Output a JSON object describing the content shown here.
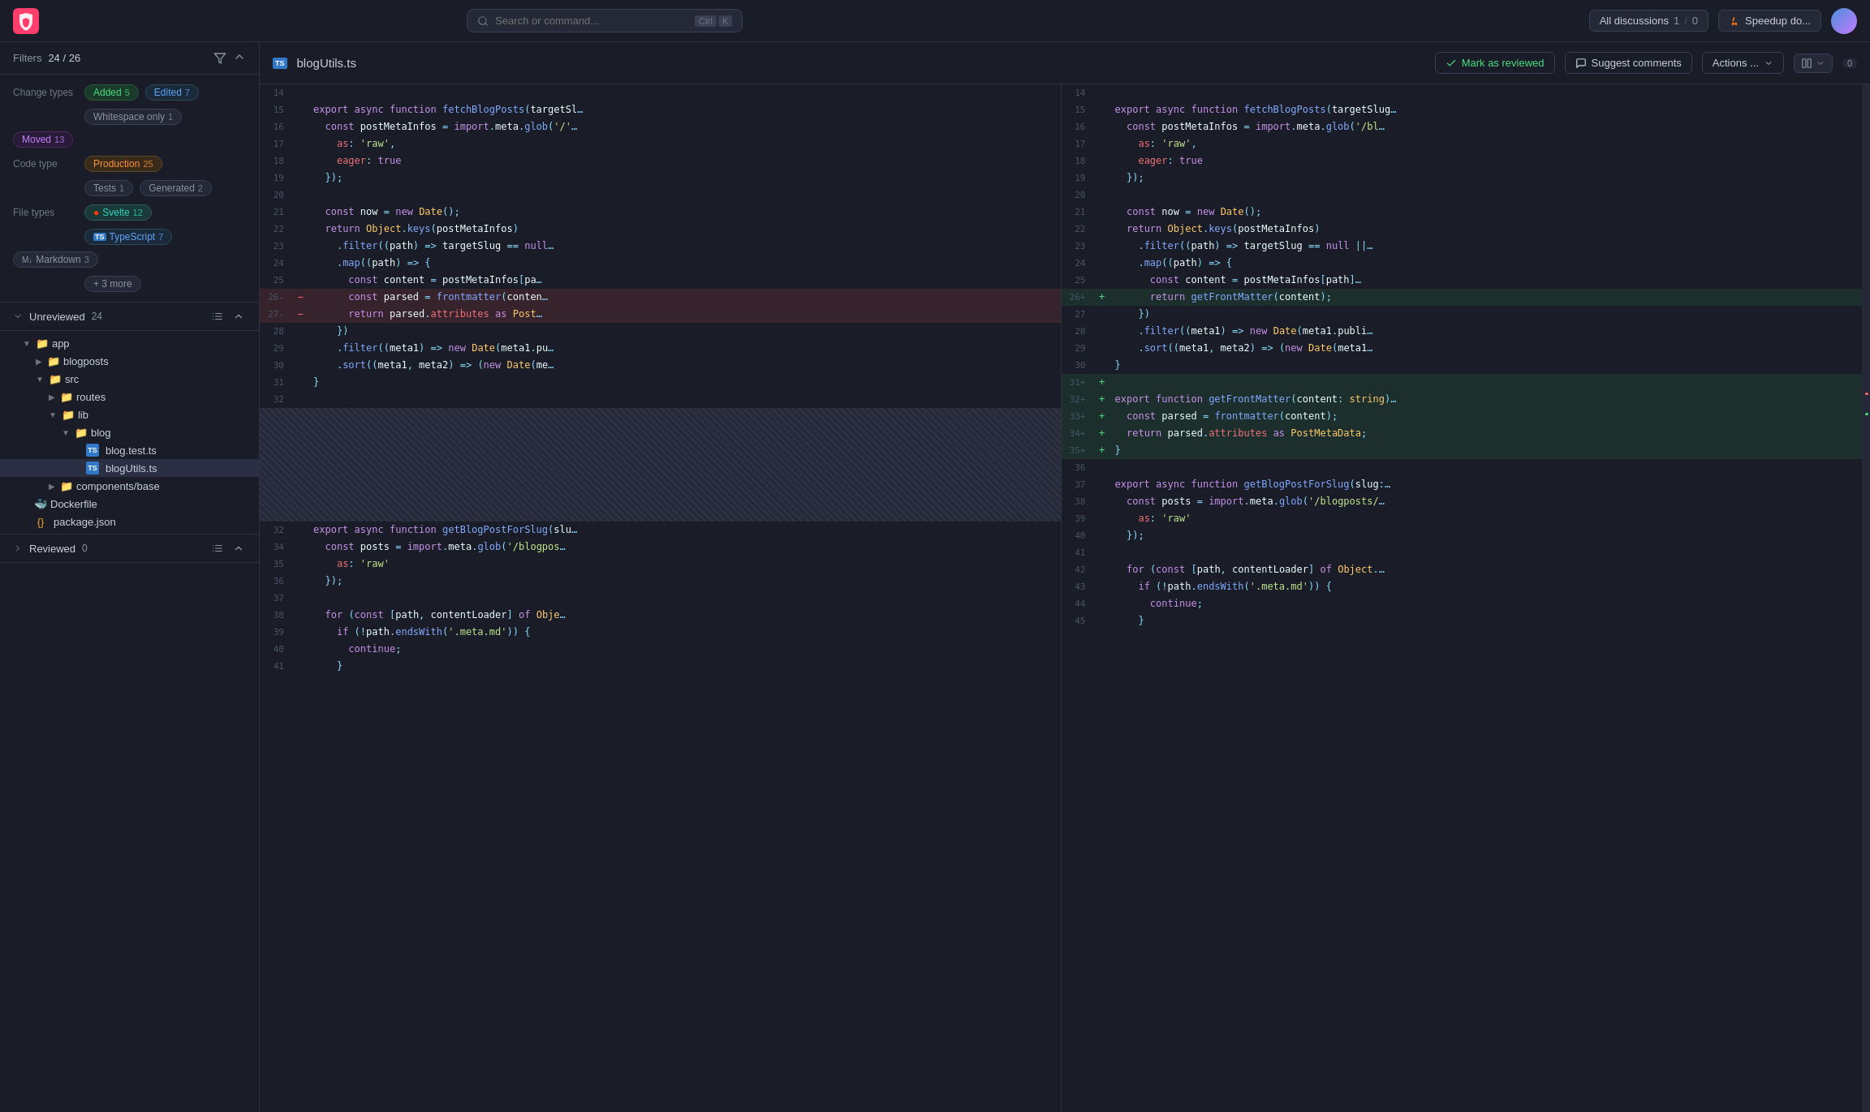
{
  "topbar": {
    "search_placeholder": "Search or command...",
    "kbd_ctrl": "Ctrl",
    "kbd_k": "K",
    "discussions_label": "All discussions",
    "discussions_count": "1",
    "discussions_zero": "0",
    "speedup_label": "Speedup do..."
  },
  "filters": {
    "title": "Filters",
    "count": "24 / 26",
    "change_types_label": "Change types",
    "added_label": "Added",
    "added_count": "5",
    "edited_label": "Edited",
    "edited_count": "7",
    "whitespace_label": "Whitespace only",
    "whitespace_count": "1",
    "moved_label": "Moved",
    "moved_count": "13",
    "code_type_label": "Code type",
    "production_label": "Production",
    "production_count": "25",
    "tests_label": "Tests",
    "tests_count": "1",
    "generated_label": "Generated",
    "generated_count": "2",
    "file_types_label": "File types",
    "svelte_label": "Svelte",
    "svelte_count": "12",
    "typescript_label": "TypeScript",
    "typescript_count": "7",
    "markdown_label": "Markdown",
    "markdown_count": "3",
    "more_label": "+ 3 more"
  },
  "unreviewed": {
    "title": "Unreviewed",
    "count": "24"
  },
  "reviewed": {
    "title": "Reviewed",
    "count": "0"
  },
  "file_tree": [
    {
      "name": "app",
      "type": "folder",
      "indent": 1,
      "expanded": true
    },
    {
      "name": "blogposts",
      "type": "folder",
      "indent": 2,
      "expanded": false
    },
    {
      "name": "src",
      "type": "folder",
      "indent": 2,
      "expanded": true
    },
    {
      "name": "routes",
      "type": "folder",
      "indent": 3,
      "expanded": false
    },
    {
      "name": "lib",
      "type": "folder",
      "indent": 3,
      "expanded": true
    },
    {
      "name": "blog",
      "type": "folder",
      "indent": 4,
      "expanded": true
    },
    {
      "name": "blog.test.ts",
      "type": "ts",
      "indent": 5
    },
    {
      "name": "blogUtils.ts",
      "type": "ts",
      "indent": 5,
      "active": true
    },
    {
      "name": "components/base",
      "type": "folder",
      "indent": 3,
      "expanded": false
    },
    {
      "name": "Dockerfile",
      "type": "docker",
      "indent": 1
    },
    {
      "name": "package.json",
      "type": "json",
      "indent": 1
    }
  ],
  "file": {
    "name": "blogUtils.ts",
    "mark_reviewed_label": "Mark as reviewed",
    "suggest_label": "Suggest comments",
    "actions_label": "Actions ...",
    "comment_count": "0"
  },
  "diff": {
    "left_lines": [
      {
        "num": "14",
        "type": "normal",
        "content": ""
      },
      {
        "num": "15",
        "type": "normal",
        "content": "export async function fetchBlogPosts(targetSl"
      },
      {
        "num": "16",
        "type": "normal",
        "content": "  const postMetaInfos = import.meta.glob('/'"
      },
      {
        "num": "17",
        "type": "normal",
        "content": "    as: 'raw',"
      },
      {
        "num": "18",
        "type": "normal",
        "content": "    eager: true"
      },
      {
        "num": "19",
        "type": "normal",
        "content": "  });"
      },
      {
        "num": "20",
        "type": "normal",
        "content": ""
      },
      {
        "num": "21",
        "type": "normal",
        "content": "  const now = new Date();"
      },
      {
        "num": "22",
        "type": "normal",
        "content": "  return Object.keys(postMetaInfos)"
      },
      {
        "num": "23",
        "type": "normal",
        "content": "    .filter((path) => targetSlug == null"
      },
      {
        "num": "24",
        "type": "normal",
        "content": "    .map((path) => {"
      },
      {
        "num": "25",
        "type": "normal",
        "content": "      const content = postMetaInfos[pa"
      },
      {
        "num": "26",
        "type": "removed",
        "content": "      const parsed = frontmatter(conten"
      },
      {
        "num": "27",
        "type": "removed",
        "content": "      return parsed.attributes as Post"
      },
      {
        "num": "28",
        "type": "normal",
        "content": "    })"
      },
      {
        "num": "29",
        "type": "normal",
        "content": "    .filter((meta1) => new Date(meta1.pu"
      },
      {
        "num": "30",
        "type": "normal",
        "content": "    .sort((meta1, meta2) => (new Date(me"
      },
      {
        "num": "31",
        "type": "normal",
        "content": "}"
      },
      {
        "num": "32",
        "type": "normal",
        "content": ""
      },
      {
        "num": "",
        "type": "empty",
        "content": ""
      },
      {
        "num": "",
        "type": "empty",
        "content": ""
      },
      {
        "num": "",
        "type": "empty",
        "content": ""
      },
      {
        "num": "",
        "type": "empty",
        "content": ""
      },
      {
        "num": "",
        "type": "empty",
        "content": ""
      },
      {
        "num": "",
        "type": "empty",
        "content": ""
      },
      {
        "num": "",
        "type": "empty",
        "content": ""
      },
      {
        "num": "",
        "type": "empty",
        "content": ""
      },
      {
        "num": "",
        "type": "empty",
        "content": ""
      },
      {
        "num": "32",
        "type": "normal",
        "content": "export async function getBlogPostForSlug(slu"
      },
      {
        "num": "34",
        "type": "normal",
        "content": "  const posts = import.meta.glob('/blogpos"
      },
      {
        "num": "35",
        "type": "normal",
        "content": "    as: 'raw'"
      },
      {
        "num": "36",
        "type": "normal",
        "content": "  });"
      },
      {
        "num": "37",
        "type": "normal",
        "content": ""
      },
      {
        "num": "38",
        "type": "normal",
        "content": "  for (const [path, contentLoader] of Obje"
      },
      {
        "num": "39",
        "type": "normal",
        "content": "    if (!path.endsWith('.meta.md')) {"
      },
      {
        "num": "40",
        "type": "normal",
        "content": "      continue;"
      },
      {
        "num": "41",
        "type": "normal",
        "content": "    }"
      }
    ],
    "right_lines": [
      {
        "num": "14",
        "type": "normal",
        "content": ""
      },
      {
        "num": "15",
        "type": "normal",
        "content": "export async function fetchBlogPosts(targetSlug"
      },
      {
        "num": "16",
        "type": "normal",
        "content": "  const postMetaInfos = import.meta.glob('/bl"
      },
      {
        "num": "17",
        "type": "normal",
        "content": "    as: 'raw',"
      },
      {
        "num": "18",
        "type": "normal",
        "content": "    eager: true"
      },
      {
        "num": "19",
        "type": "normal",
        "content": "  });"
      },
      {
        "num": "20",
        "type": "normal",
        "content": ""
      },
      {
        "num": "21",
        "type": "normal",
        "content": "  const now = new Date();"
      },
      {
        "num": "22",
        "type": "normal",
        "content": "  return Object.keys(postMetaInfos)"
      },
      {
        "num": "23",
        "type": "normal",
        "content": "    .filter((path) => targetSlug == null ||"
      },
      {
        "num": "24",
        "type": "normal",
        "content": "    .map((path) => {"
      },
      {
        "num": "25",
        "type": "normal",
        "content": "      const content = postMetaInfos[path]"
      },
      {
        "num": "26",
        "type": "added",
        "content": "      return getFrontMatter(content);"
      },
      {
        "num": "27",
        "type": "normal",
        "content": "    })"
      },
      {
        "num": "28",
        "type": "normal",
        "content": "    .filter((meta1) => new Date(meta1.publi"
      },
      {
        "num": "29",
        "type": "normal",
        "content": "    .sort((meta1, meta2) => (new Date(meta1"
      },
      {
        "num": "30",
        "type": "normal",
        "content": "}"
      },
      {
        "num": "31",
        "type": "added_empty",
        "content": ""
      },
      {
        "num": "32",
        "type": "added",
        "content": "export function getFrontMatter(content: string)"
      },
      {
        "num": "33",
        "type": "added",
        "content": "  const parsed = frontmatter(content);"
      },
      {
        "num": "34",
        "type": "added",
        "content": "  return parsed.attributes as PostMetaData;"
      },
      {
        "num": "35",
        "type": "added",
        "content": "}"
      },
      {
        "num": "36",
        "type": "normal",
        "content": ""
      },
      {
        "num": "37",
        "type": "normal",
        "content": "export async function getBlogPostForSlug(slug:"
      },
      {
        "num": "38",
        "type": "normal",
        "content": "  const posts = import.meta.glob('/blogposts/"
      },
      {
        "num": "39",
        "type": "normal",
        "content": "    as: 'raw'"
      },
      {
        "num": "40",
        "type": "normal",
        "content": "  });"
      },
      {
        "num": "41",
        "type": "normal",
        "content": ""
      },
      {
        "num": "42",
        "type": "normal",
        "content": "  for (const [path, contentLoader] of Object."
      },
      {
        "num": "43",
        "type": "normal",
        "content": "    if (!path.endsWith('.meta.md')) {"
      },
      {
        "num": "44",
        "type": "normal",
        "content": "      continue;"
      },
      {
        "num": "45",
        "type": "normal",
        "content": "    }"
      }
    ]
  }
}
